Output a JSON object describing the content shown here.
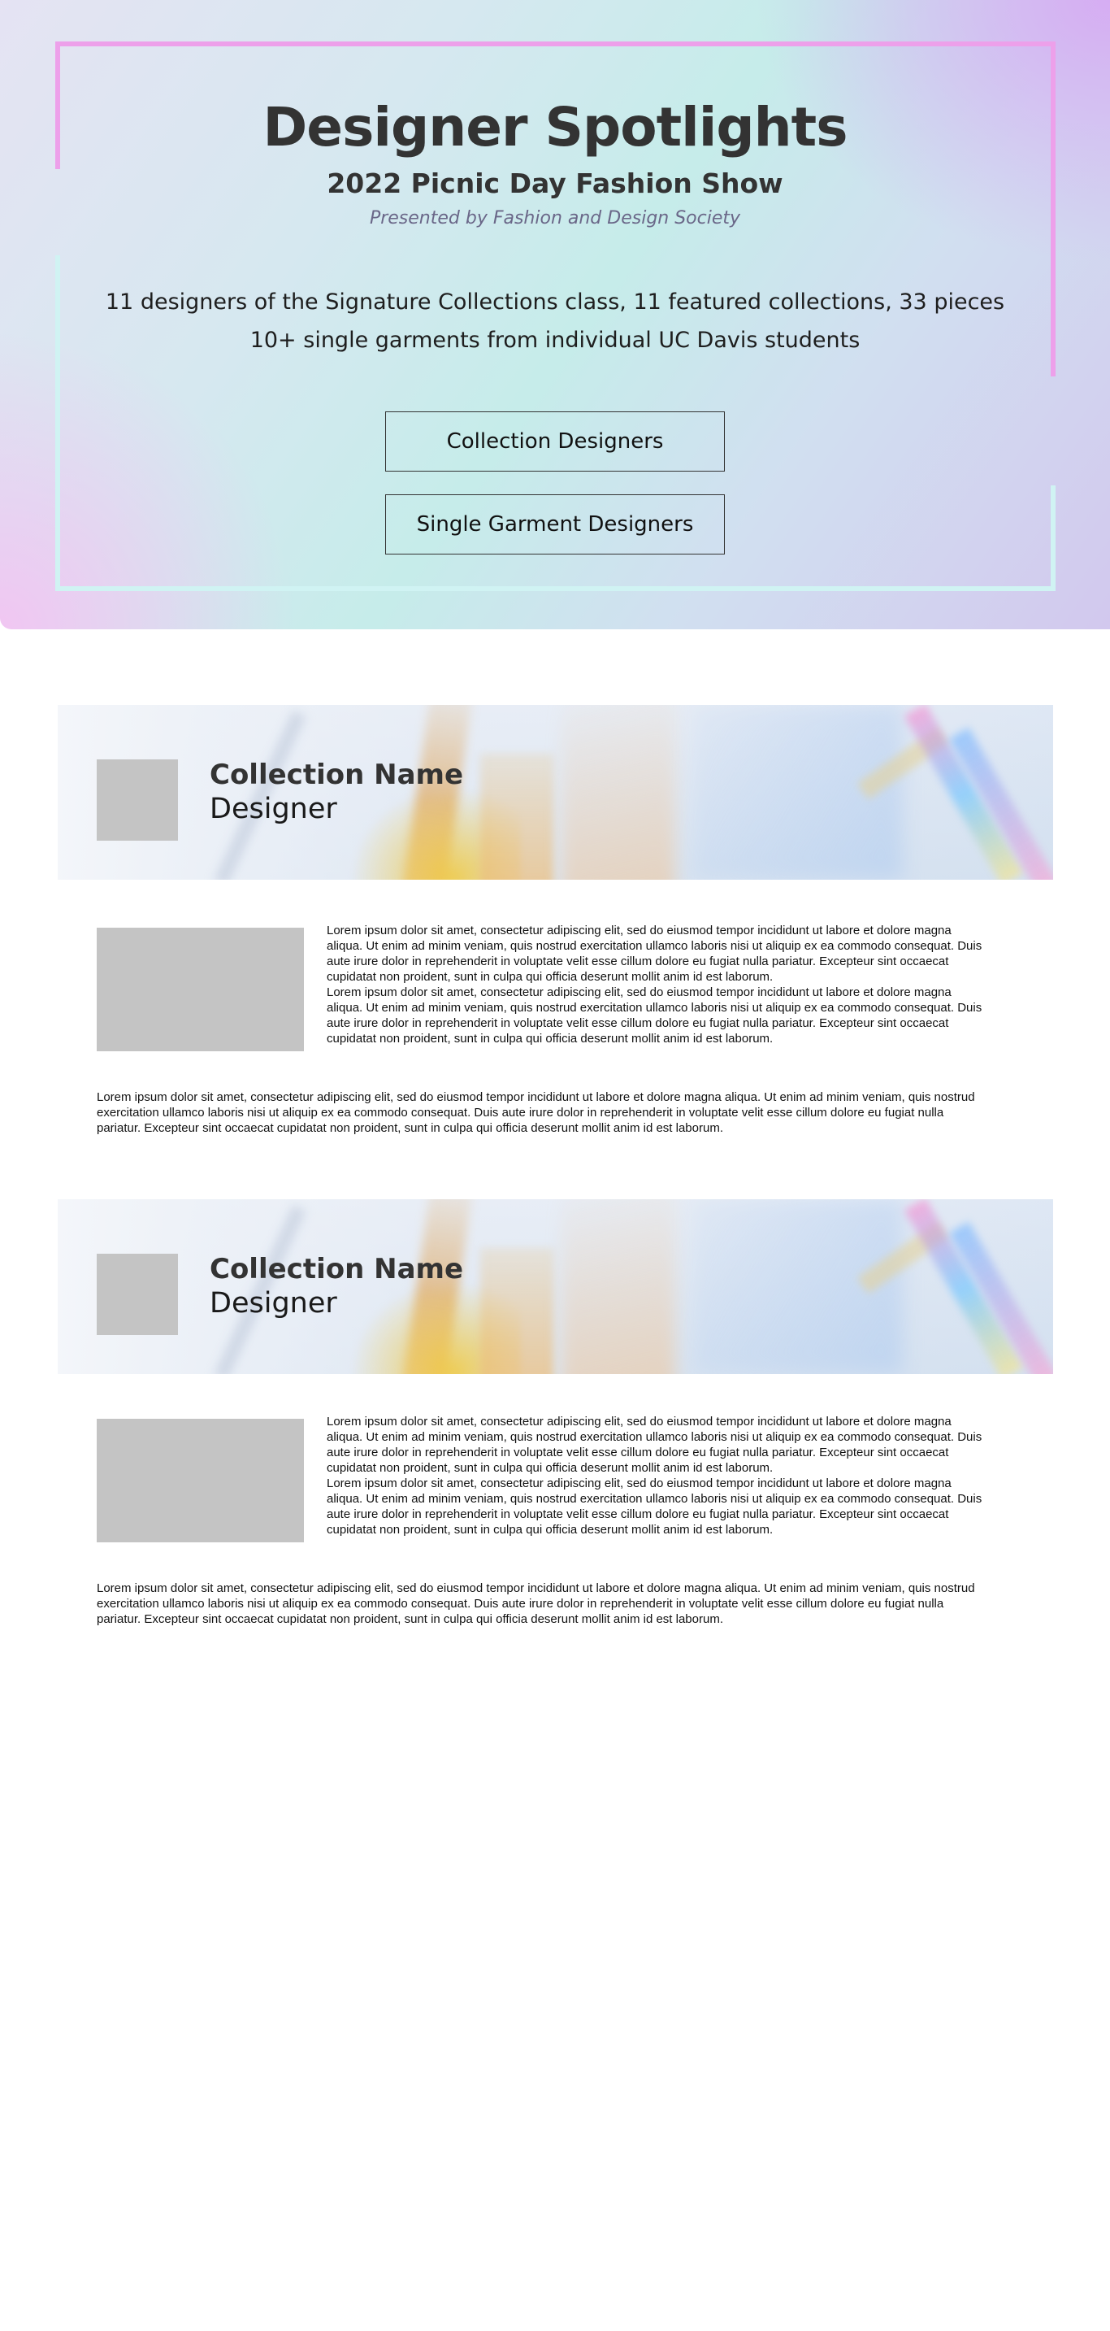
{
  "hero": {
    "title": "Designer Spotlights",
    "subtitle": "2022 Picnic Day Fashion Show",
    "presented_by": "Presented by Fashion and Design Society",
    "line1": "11 designers of the Signature Collections class, 11 featured collections, 33 pieces",
    "line2": "10+ single garments from individual UC Davis students",
    "buttons": [
      {
        "label": "Collection Designers"
      },
      {
        "label": "Single Garment Designers"
      }
    ],
    "colors": {
      "frame_pink": "#eda0ea",
      "frame_cyan": "#d0f3f3",
      "title": "#333333"
    }
  },
  "collections": [
    {
      "name": "Collection Name",
      "designer": "Designer",
      "para_right_1": "Lorem ipsum dolor sit amet, consectetur adipiscing elit, sed do eiusmod tempor incididunt ut labore et dolore magna aliqua. Ut enim ad minim veniam, quis nostrud exercitation ullamco laboris nisi ut aliquip ex ea commodo consequat. Duis aute irure dolor in reprehenderit in voluptate velit esse cillum dolore eu fugiat nulla pariatur. Excepteur sint occaecat cupidatat non proident, sunt in culpa qui officia deserunt mollit anim id est laborum.",
      "para_right_2": "Lorem ipsum dolor sit amet, consectetur adipiscing elit, sed do eiusmod tempor incididunt ut labore et dolore magna aliqua. Ut enim ad minim veniam, quis nostrud exercitation ullamco laboris nisi ut aliquip ex ea commodo consequat. Duis aute irure dolor in reprehenderit in voluptate velit esse cillum dolore eu fugiat nulla pariatur. Excepteur sint occaecat cupidatat non proident, sunt in culpa qui officia deserunt mollit anim id est laborum.",
      "para_wide": "Lorem ipsum dolor sit amet, consectetur adipiscing elit, sed do eiusmod tempor incididunt ut labore et dolore magna aliqua. Ut enim ad minim veniam, quis nostrud exercitation ullamco laboris nisi ut aliquip ex ea commodo consequat. Duis aute irure dolor in reprehenderit in voluptate velit esse cillum dolore eu fugiat nulla pariatur. Excepteur sint occaecat cupidatat non proident, sunt in culpa qui officia deserunt mollit anim id est laborum."
    },
    {
      "name": "Collection Name",
      "designer": "Designer",
      "para_right_1": "Lorem ipsum dolor sit amet, consectetur adipiscing elit, sed do eiusmod tempor incididunt ut labore et dolore magna aliqua. Ut enim ad minim veniam, quis nostrud exercitation ullamco laboris nisi ut aliquip ex ea commodo consequat. Duis aute irure dolor in reprehenderit in voluptate velit esse cillum dolore eu fugiat nulla pariatur. Excepteur sint occaecat cupidatat non proident, sunt in culpa qui officia deserunt mollit anim id est laborum.",
      "para_right_2": "Lorem ipsum dolor sit amet, consectetur adipiscing elit, sed do eiusmod tempor incididunt ut labore et dolore magna aliqua. Ut enim ad minim veniam, quis nostrud exercitation ullamco laboris nisi ut aliquip ex ea commodo consequat. Duis aute irure dolor in reprehenderit in voluptate velit esse cillum dolore eu fugiat nulla pariatur. Excepteur sint occaecat cupidatat non proident, sunt in culpa qui officia deserunt mollit anim id est laborum.",
      "para_wide": "Lorem ipsum dolor sit amet, consectetur adipiscing elit, sed do eiusmod tempor incididunt ut labore et dolore magna aliqua. Ut enim ad minim veniam, quis nostrud exercitation ullamco laboris nisi ut aliquip ex ea commodo consequat. Duis aute irure dolor in reprehenderit in voluptate velit esse cillum dolore eu fugiat nulla pariatur. Excepteur sint occaecat cupidatat non proident, sunt in culpa qui officia deserunt mollit anim id est laborum."
    }
  ]
}
